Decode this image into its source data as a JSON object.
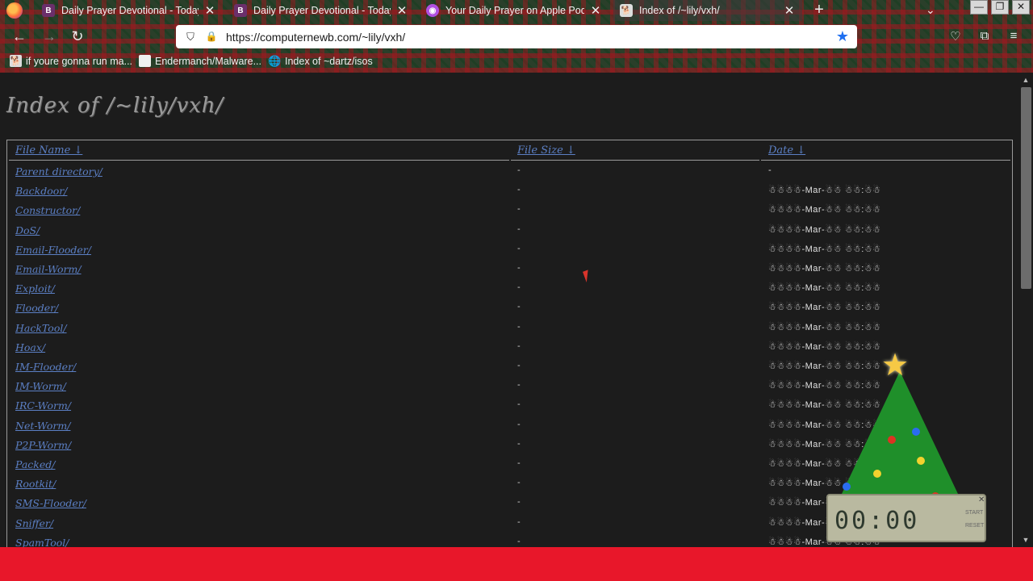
{
  "tabs": [
    {
      "title": "Daily Prayer Devotional - Today's Devotional",
      "favicon": "B",
      "active": false
    },
    {
      "title": "Daily Prayer Devotional - Today's Devotional",
      "favicon": "B",
      "active": false
    },
    {
      "title": "Your Daily Prayer on Apple Podcasts",
      "favicon": "podcast-icon",
      "active": false
    },
    {
      "title": "Index of /~lily/vxh/",
      "favicon": "dog-icon",
      "active": true
    }
  ],
  "new_tab": "+",
  "address_bar": {
    "url": "https://computernewb.com/~lily/vxh/"
  },
  "bookmarks": [
    {
      "label": "if youre gonna run ma...",
      "icon": "dog-icon"
    },
    {
      "label": "Endermanch/Malware...",
      "icon": "page-icon"
    },
    {
      "label": "Index of ~dartz/isos",
      "icon": "globe-icon"
    }
  ],
  "page": {
    "title": "Index of /~lily/vxh/",
    "headers": {
      "name": "File Name  ↓",
      "size": "File Size  ↓",
      "date": "Date  ↓"
    },
    "rows": [
      {
        "name": "Parent directory/",
        "size": "-",
        "date": "-"
      },
      {
        "name": "Backdoor/",
        "size": "-",
        "date": "☃☃☃☃-Mar-☃☃ ☃☃:☃☃"
      },
      {
        "name": "Constructor/",
        "size": "-",
        "date": "☃☃☃☃-Mar-☃☃ ☃☃:☃☃"
      },
      {
        "name": "DoS/",
        "size": "-",
        "date": "☃☃☃☃-Mar-☃☃ ☃☃:☃☃"
      },
      {
        "name": "Email-Flooder/",
        "size": "-",
        "date": "☃☃☃☃-Mar-☃☃ ☃☃:☃☃"
      },
      {
        "name": "Email-Worm/",
        "size": "-",
        "date": "☃☃☃☃-Mar-☃☃ ☃☃:☃☃"
      },
      {
        "name": "Exploit/",
        "size": "-",
        "date": "☃☃☃☃-Mar-☃☃ ☃☃:☃☃"
      },
      {
        "name": "Flooder/",
        "size": "-",
        "date": "☃☃☃☃-Mar-☃☃ ☃☃:☃☃"
      },
      {
        "name": "HackTool/",
        "size": "-",
        "date": "☃☃☃☃-Mar-☃☃ ☃☃:☃☃"
      },
      {
        "name": "Hoax/",
        "size": "-",
        "date": "☃☃☃☃-Mar-☃☃ ☃☃:☃☃"
      },
      {
        "name": "IM-Flooder/",
        "size": "-",
        "date": "☃☃☃☃-Mar-☃☃ ☃☃:☃☃"
      },
      {
        "name": "IM-Worm/",
        "size": "-",
        "date": "☃☃☃☃-Mar-☃☃ ☃☃:☃☃"
      },
      {
        "name": "IRC-Worm/",
        "size": "-",
        "date": "☃☃☃☃-Mar-☃☃ ☃☃:☃☃"
      },
      {
        "name": "Net-Worm/",
        "size": "-",
        "date": "☃☃☃☃-Mar-☃☃ ☃☃:☃☃"
      },
      {
        "name": "P2P-Worm/",
        "size": "-",
        "date": "☃☃☃☃-Mar-☃☃ ☃☃:☃☃"
      },
      {
        "name": "Packed/",
        "size": "-",
        "date": "☃☃☃☃-Mar-☃☃ ☃☃:☃☃"
      },
      {
        "name": "Rootkit/",
        "size": "-",
        "date": "☃☃☃☃-Mar-☃☃ ☃☃:☃☃"
      },
      {
        "name": "SMS-Flooder/",
        "size": "-",
        "date": "☃☃☃☃-Mar-☃☃ ☃☃:☃☃"
      },
      {
        "name": "Sniffer/",
        "size": "-",
        "date": "☃☃☃☃-Mar-☃☃ ☃☃:☃☃"
      },
      {
        "name": "SpamTool/",
        "size": "-",
        "date": "☃☃☃☃-Mar-☃☃ ☃☃:☃☃"
      }
    ]
  },
  "clock_widget": {
    "digits": "00:00",
    "start_label": "START",
    "reset_label": "RESET",
    "close": "✕"
  },
  "colors": {
    "link": "#5b7fc4",
    "page_bg": "#1c1c1c",
    "bottom_band": "#e8172a",
    "star_bookmark": "#1f6ff0"
  }
}
